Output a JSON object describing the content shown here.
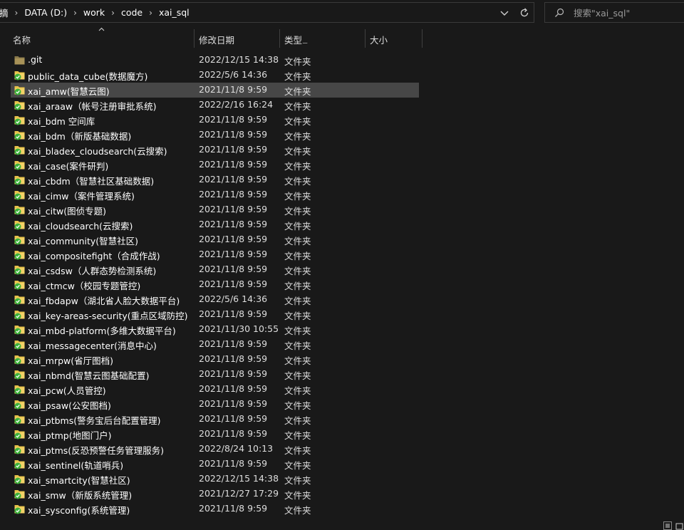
{
  "address_bar": {
    "crumbs": [
      "摘",
      "DATA (D:)",
      "work",
      "code",
      "xai_sql"
    ]
  },
  "search": {
    "placeholder": "搜索\"xai_sql\""
  },
  "columns": {
    "name": "名称",
    "date": "修改日期",
    "type": "类型",
    "size": "大小"
  },
  "files": [
    {
      "name": ".git",
      "date": "2022/12/15 14:38",
      "type": "文件夹",
      "icon": "folder-icon"
    },
    {
      "name": "public_data_cube(数据魔方)",
      "date": "2022/5/6 14:36",
      "type": "文件夹",
      "icon": "folder-synced-icon"
    },
    {
      "name": "xai_amw(智慧云图)",
      "date": "2021/11/8 9:59",
      "type": "文件夹",
      "icon": "folder-synced-icon"
    },
    {
      "name": "xai_araaw（帐号注册审批系统)",
      "date": "2022/2/16 16:24",
      "type": "文件夹",
      "icon": "folder-synced-icon"
    },
    {
      "name": "xai_bdm 空间库",
      "date": "2021/11/8 9:59",
      "type": "文件夹",
      "icon": "folder-synced-icon"
    },
    {
      "name": "xai_bdm（新版基础数据)",
      "date": "2021/11/8 9:59",
      "type": "文件夹",
      "icon": "folder-synced-icon"
    },
    {
      "name": "xai_bladex_cloudsearch(云搜索)",
      "date": "2021/11/8 9:59",
      "type": "文件夹",
      "icon": "folder-synced-icon"
    },
    {
      "name": "xai_case(案件研判)",
      "date": "2021/11/8 9:59",
      "type": "文件夹",
      "icon": "folder-synced-icon"
    },
    {
      "name": "xai_cbdm（智慧社区基础数据)",
      "date": "2021/11/8 9:59",
      "type": "文件夹",
      "icon": "folder-synced-icon"
    },
    {
      "name": "xai_cimw（案件管理系统)",
      "date": "2021/11/8 9:59",
      "type": "文件夹",
      "icon": "folder-synced-icon"
    },
    {
      "name": "xai_citw(图侦专题)",
      "date": "2021/11/8 9:59",
      "type": "文件夹",
      "icon": "folder-synced-icon"
    },
    {
      "name": "xai_cloudsearch(云搜索)",
      "date": "2021/11/8 9:59",
      "type": "文件夹",
      "icon": "folder-synced-icon"
    },
    {
      "name": "xai_community(智慧社区)",
      "date": "2021/11/8 9:59",
      "type": "文件夹",
      "icon": "folder-synced-icon"
    },
    {
      "name": "xai_compositefight（合成作战)",
      "date": "2021/11/8 9:59",
      "type": "文件夹",
      "icon": "folder-synced-icon"
    },
    {
      "name": "xai_csdsw（人群态势检测系统)",
      "date": "2021/11/8 9:59",
      "type": "文件夹",
      "icon": "folder-synced-icon"
    },
    {
      "name": "xai_ctmcw（校园专题管控)",
      "date": "2021/11/8 9:59",
      "type": "文件夹",
      "icon": "folder-synced-icon"
    },
    {
      "name": "xai_fbdapw（湖北省人脸大数据平台)",
      "date": "2022/5/6 14:36",
      "type": "文件夹",
      "icon": "folder-synced-icon"
    },
    {
      "name": "xai_key-areas-security(重点区域防控)",
      "date": "2021/11/8 9:59",
      "type": "文件夹",
      "icon": "folder-synced-icon"
    },
    {
      "name": "xai_mbd-platform(多维大数据平台)",
      "date": "2021/11/30 10:55",
      "type": "文件夹",
      "icon": "folder-synced-icon"
    },
    {
      "name": "xai_messagecenter(消息中心)",
      "date": "2021/11/8 9:59",
      "type": "文件夹",
      "icon": "folder-synced-icon"
    },
    {
      "name": "xai_mrpw(省厅图档)",
      "date": "2021/11/8 9:59",
      "type": "文件夹",
      "icon": "folder-synced-icon"
    },
    {
      "name": "xai_nbmd(智慧云图基础配置)",
      "date": "2021/11/8 9:59",
      "type": "文件夹",
      "icon": "folder-synced-icon"
    },
    {
      "name": "xai_pcw(人员管控)",
      "date": "2021/11/8 9:59",
      "type": "文件夹",
      "icon": "folder-synced-icon"
    },
    {
      "name": "xai_psaw(公安图档)",
      "date": "2021/11/8 9:59",
      "type": "文件夹",
      "icon": "folder-synced-icon"
    },
    {
      "name": "xai_ptbms(警务宝后台配置管理)",
      "date": "2021/11/8 9:59",
      "type": "文件夹",
      "icon": "folder-synced-icon"
    },
    {
      "name": "xai_ptmp(地图门户)",
      "date": "2021/11/8 9:59",
      "type": "文件夹",
      "icon": "folder-synced-icon"
    },
    {
      "name": "xai_ptms(反恐预警任务管理服务)",
      "date": "2022/8/24 10:13",
      "type": "文件夹",
      "icon": "folder-synced-icon"
    },
    {
      "name": "xai_sentinel(轨道哨兵)",
      "date": "2021/11/8 9:59",
      "type": "文件夹",
      "icon": "folder-synced-icon"
    },
    {
      "name": "xai_smartcity(智慧社区)",
      "date": "2022/12/15 14:38",
      "type": "文件夹",
      "icon": "folder-synced-icon"
    },
    {
      "name": "xai_smw（新版系统管理)",
      "date": "2021/12/27 17:29",
      "type": "文件夹",
      "icon": "folder-synced-icon"
    },
    {
      "name": "xai_sysconfig(系统管理)",
      "date": "2021/11/8 9:59",
      "type": "文件夹",
      "icon": "folder-synced-icon"
    }
  ],
  "selected_row_index": 2,
  "colors": {
    "background": "#191919",
    "selected_row": "#474747",
    "folder_yellow": "#e8c34a",
    "sync_green": "#3db13a"
  }
}
